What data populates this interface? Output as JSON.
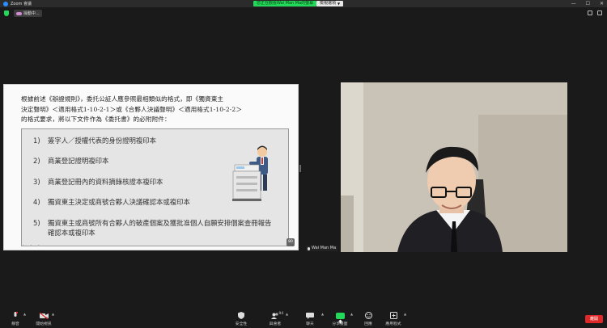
{
  "window": {
    "app_title": "Zoom 會議",
    "screen_share_banner": "您正在觀看Wai Man Ma的螢幕",
    "view_options_label": "檢視選項"
  },
  "topbar": {
    "share_pill_label": "操動中..."
  },
  "slide": {
    "header_lines": [
      "根據前述《辦證規則》，委托公証人應參照最相類似的格式，即《獨資東主",
      "決定聲明》＜適用格式1-10-2-1＞或《合夥人決議聲明》＜適用格式1-10-2-2＞",
      "的格式要求，將以下文件作為《委托書》的必附附件："
    ],
    "items": [
      {
        "num": "1)",
        "text": "簽字人／授權代表的身份證明複印本"
      },
      {
        "num": "2)",
        "text": "商業登記證明複印本"
      },
      {
        "num": "3)",
        "text": "商業登記冊內的資料摘錄核證本複印本"
      },
      {
        "num": "4)",
        "text": "獨資東主決定或商號合夥人決議確認本或複印本"
      },
      {
        "num": "5)",
        "text": "獨資東主或商號所有合夥人的破產個案及獲批准個人自願安排個案查冊報告確認本或複印本"
      }
    ],
    "page_number": "80",
    "illustration": "person-at-copier"
  },
  "video": {
    "participant_name": "Wai Man Ma"
  },
  "toolbar": {
    "items": [
      {
        "name": "mute",
        "label": "靜音",
        "icon": "microphone-icon"
      },
      {
        "name": "stop-video",
        "label": "開始視訊",
        "icon": "video-camera-icon"
      },
      {
        "name": "security",
        "label": "安全性",
        "icon": "shield-icon"
      },
      {
        "name": "participants",
        "label": "與會者",
        "icon": "participants-icon",
        "count": "94"
      },
      {
        "name": "chat",
        "label": "聊天",
        "icon": "chat-icon"
      },
      {
        "name": "share-screen",
        "label": "分享畫面",
        "icon": "share-screen-icon"
      },
      {
        "name": "reactions",
        "label": "回應",
        "icon": "reactions-icon"
      },
      {
        "name": "apps",
        "label": "應用程式",
        "icon": "apps-icon"
      }
    ],
    "end_label": "離開"
  },
  "colors": {
    "accent_green": "#23d959",
    "end_red": "#e02828",
    "zoom_blue": "#2d8cff"
  }
}
